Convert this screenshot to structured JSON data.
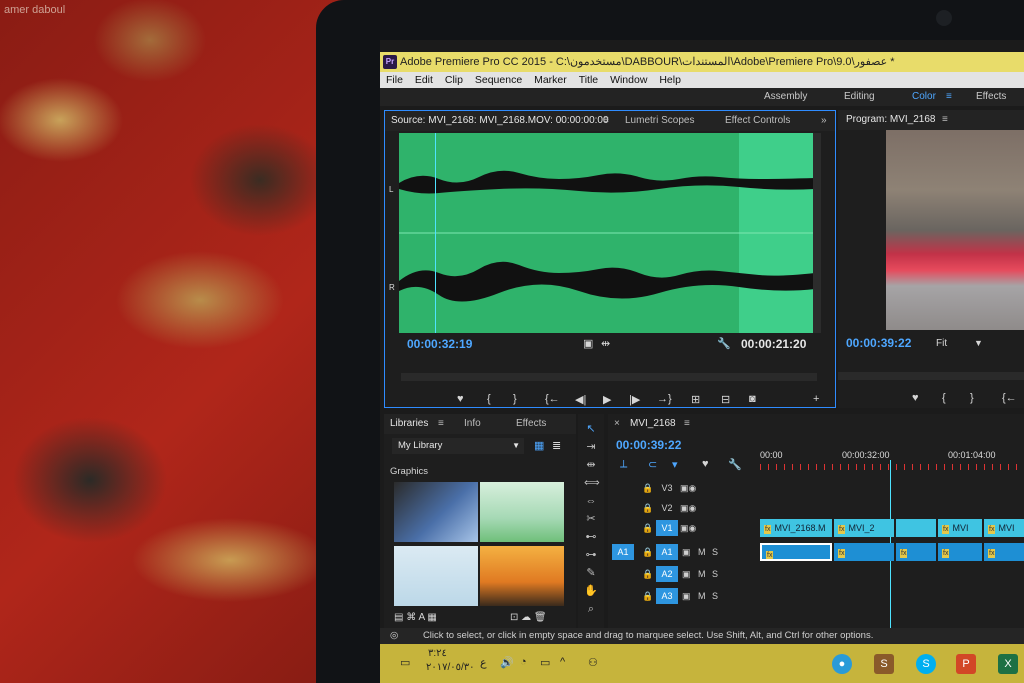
{
  "watermark": "amer daboul",
  "window": {
    "app_icon": "Pr",
    "title": "Adobe Premiere Pro CC 2015 - C:\\مستخدمون\\DABBOUR\\المستندات\\Adobe\\Premiere Pro\\9.0\\عصفور *"
  },
  "menu": [
    "File",
    "Edit",
    "Clip",
    "Sequence",
    "Marker",
    "Title",
    "Window",
    "Help"
  ],
  "workspaces": {
    "items": [
      "Assembly",
      "Editing",
      "Color",
      "Effects"
    ],
    "active": "Color"
  },
  "source_panel": {
    "tabs": [
      "Source: MVI_2168: MVI_2168.MOV: 00:00:00:00",
      "Lumetri Scopes",
      "Effect Controls"
    ],
    "channel_left": "L",
    "channel_right": "R",
    "timecode_current": "00:00:32:19",
    "timecode_duration": "00:00:21:20"
  },
  "program_panel": {
    "tab": "Program: MVI_2168",
    "timecode": "00:00:39:22",
    "fit": "Fit"
  },
  "libraries_panel": {
    "tabs": [
      "Libraries",
      "Info",
      "Effects"
    ],
    "library_select": "My Library",
    "section": "Graphics"
  },
  "timeline": {
    "sequence": "MVI_2168",
    "timecode": "00:00:39:22",
    "ruler": [
      "00:00",
      "00:00:32:00",
      "00:01:04:00"
    ],
    "video_tracks": [
      "V3",
      "V2",
      "V1"
    ],
    "audio_tracks": [
      "A1",
      "A2",
      "A3"
    ],
    "source_patch": "A1",
    "mute": "M",
    "solo": "S",
    "clips": [
      "MVI_2168.M",
      "MVI_2",
      "MVI",
      "MVI"
    ]
  },
  "status_bar": "Click to select, or click in empty space and drag to marquee select. Use Shift, Alt, and Ctrl for other options.",
  "taskbar": {
    "time": "٣:٢٤",
    "date": "٢٠١٧/٠٥/٣٠",
    "lang": "ع"
  },
  "colors": {
    "accent": "#2f8cff",
    "waveform": "#2fb36b",
    "taskbar": "#c6b43c",
    "clip_video": "#3fc4e2",
    "clip_audio": "#1e8fd4"
  }
}
